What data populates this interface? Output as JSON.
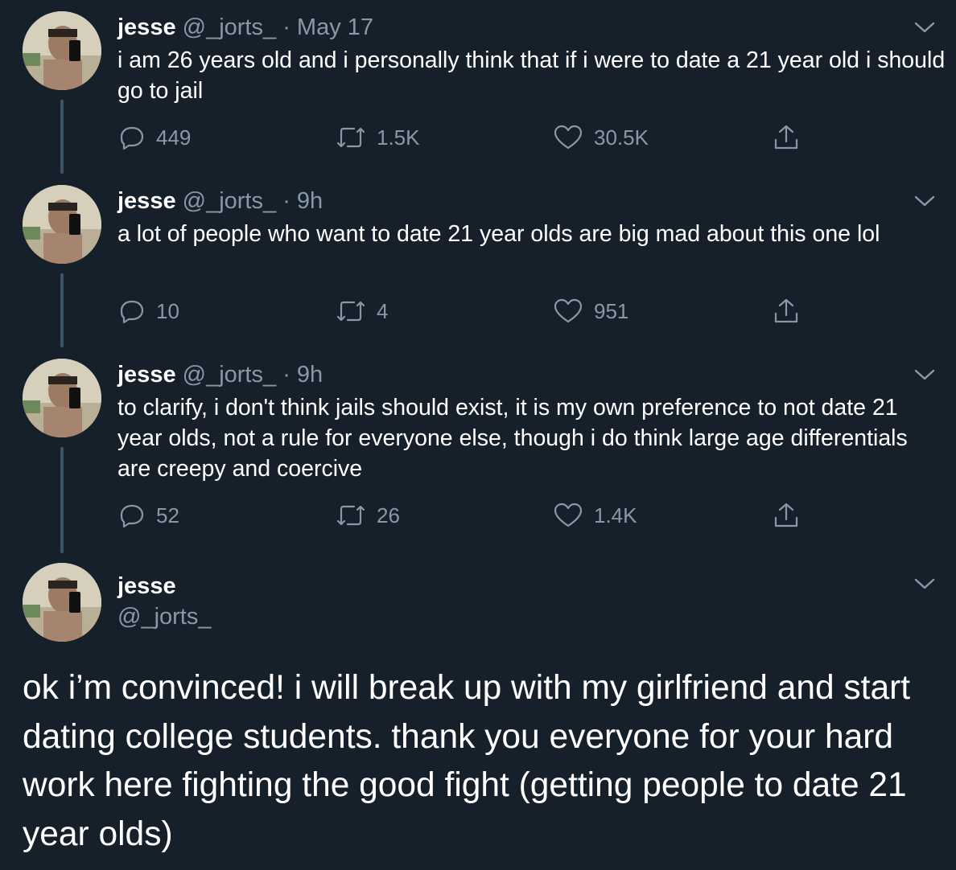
{
  "colors": {
    "background": "#15202b",
    "text": "#ffffff",
    "secondary": "#8899a6",
    "thread_line": "#3d5466"
  },
  "author": {
    "name": "jesse",
    "handle": "@_jorts_"
  },
  "tweets": [
    {
      "separator": "·",
      "time": "May 17",
      "text": "i am 26 years old and i personally think that if i were to date a 21 year old i should go to jail",
      "replies": "449",
      "retweets": "1.5K",
      "likes": "30.5K"
    },
    {
      "separator": "·",
      "time": "9h",
      "text": "a lot of people who want to date 21 year olds are big mad about this one lol",
      "replies": "10",
      "retweets": "4",
      "likes": "951"
    },
    {
      "separator": "·",
      "time": "9h",
      "text": "to clarify, i don't think jails should exist, it is my own preference to not date 21 year olds, not  a rule for everyone else, though i do think large age differentials are creepy and coercive",
      "replies": "52",
      "retweets": "26",
      "likes": "1.4K"
    }
  ],
  "main_tweet": {
    "text": "ok i’m convinced! i will break up with my girlfriend and start dating college students. thank you everyone for your hard work here fighting the good fight (getting people to date 21 year olds)"
  },
  "icons": {
    "reply": "reply-icon",
    "retweet": "retweet-icon",
    "like": "heart-icon",
    "share": "share-icon",
    "menu": "chevron-down-icon"
  }
}
